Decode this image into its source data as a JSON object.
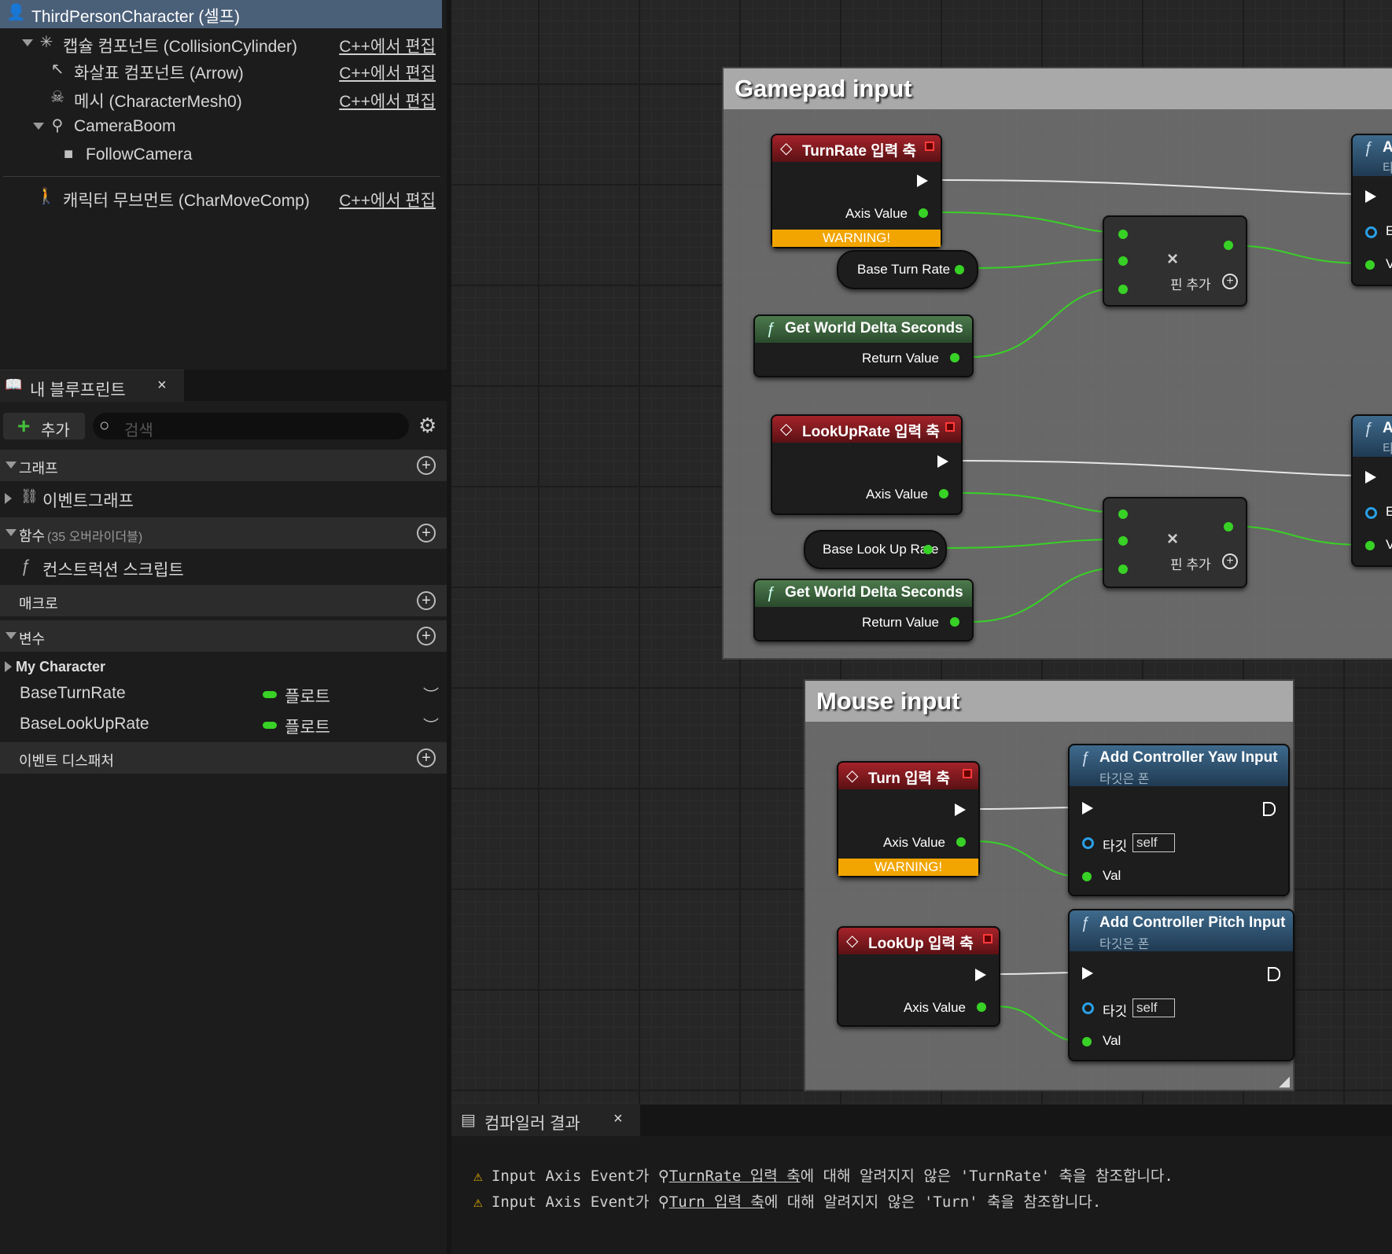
{
  "components": {
    "root": "ThirdPersonCharacter (셀프)",
    "items": [
      {
        "label": "캡슐 컴포넌트 (CollisionCylinder)",
        "edit": "C++에서 편집"
      },
      {
        "label": "화살표 컴포넌트 (Arrow)",
        "edit": "C++에서 편집"
      },
      {
        "label": "메시 (CharacterMesh0)",
        "edit": "C++에서 편집"
      },
      {
        "label": "CameraBoom",
        "edit": ""
      },
      {
        "label": "FollowCamera",
        "edit": ""
      },
      {
        "label": "캐릭터 무브먼트 (CharMoveComp)",
        "edit": "C++에서 편집"
      }
    ]
  },
  "my_blueprint": {
    "tab_label": "내 블루프린트",
    "add_label": "추가",
    "search_placeholder": "검색",
    "sections": {
      "graphs": "그래프",
      "event_graph": "이벤트그래프",
      "functions": "함수",
      "functions_count": "(35 오버라이더블)",
      "construction_script": "컨스트럭션 스크립트",
      "macros": "매크로",
      "variables": "변수",
      "category": "My Character",
      "dispatchers": "이벤트 디스패처"
    },
    "variables": [
      {
        "name": "BaseTurnRate",
        "type": "플로트"
      },
      {
        "name": "BaseLookUpRate",
        "type": "플로트"
      }
    ],
    "var_color": "#38d126"
  },
  "graph": {
    "gamepad_comment": "Gamepad input",
    "mouse_comment": "Mouse input",
    "turnrate_title": "TurnRate 입력 축",
    "lookuprate_title": "LookUpRate 입력 축",
    "turn_title": "Turn 입력 축",
    "lookup_title": "LookUp 입력 축",
    "axis_value": "Axis Value",
    "warning": "WARNING!",
    "base_turn_rate": "Base Turn Rate",
    "base_lookup_rate": "Base Look Up Rate",
    "world_delta": "Get World Delta Seconds",
    "return_value": "Return Value",
    "add_pin": "핀 추가",
    "add_yaw": "Add Controller Yaw Input",
    "add_pitch": "Add Controller Pitch Input",
    "target_pawn": "타깃은 폰",
    "target": "타깃",
    "self_val": "self",
    "val": "Val",
    "cut_ac": "Ac",
    "cut_ta": "타",
    "cut_e": "E",
    "cut_v": "V"
  },
  "compiler": {
    "tab_label": "컴파일러 결과",
    "messages": [
      {
        "prefix": "Input Axis Event가",
        "link": "TurnRate 입력 축",
        "suffix": "에 대해 알려지지 않은 'TurnRate' 축을 참조합니다."
      },
      {
        "prefix": "Input Axis Event가",
        "link": "Turn 입력 축",
        "suffix": "에 대해 알려지지 않은 'Turn' 축을 참조합니다."
      }
    ]
  },
  "colors": {
    "event_header": "#a4232a",
    "pure_header": "#4d7a4d",
    "function_header": "#3e6a8c",
    "float_pin": "#38d126",
    "object_pin": "#2aa0e8",
    "warning": "#f2a500"
  }
}
